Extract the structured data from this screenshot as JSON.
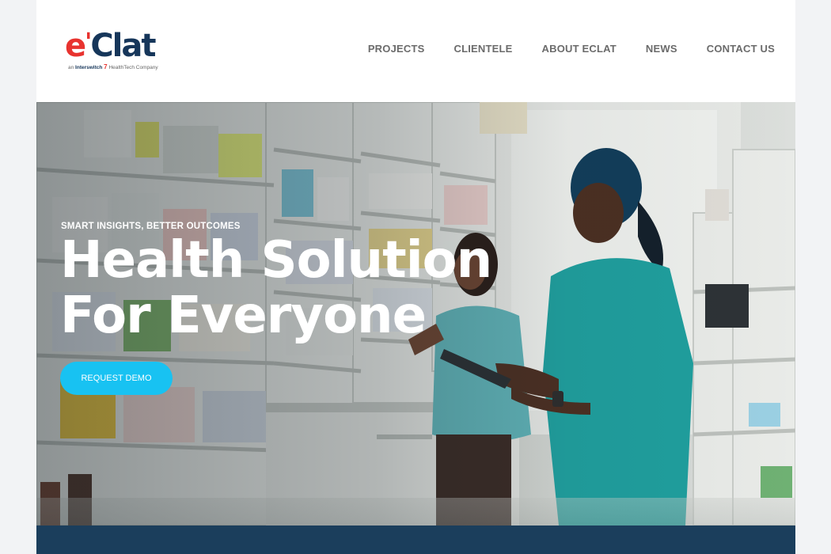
{
  "logo": {
    "e": "e",
    "apos": "'",
    "clat": "Clat",
    "tag_prefix": "an",
    "tag_brand": "Interswitch",
    "tag_mark": "7",
    "tag_suffix": "HealthTech Company"
  },
  "nav": {
    "items": [
      {
        "label": "PROJECTS"
      },
      {
        "label": "CLIENTELE"
      },
      {
        "label": "ABOUT ECLAT"
      },
      {
        "label": "NEWS"
      },
      {
        "label": "CONTACT US"
      }
    ]
  },
  "hero": {
    "eyebrow": "SMART INSIGHTS, BETTER OUTCOMES",
    "headline_line1": "Health Solution",
    "headline_line2": "For Everyone",
    "cta_label": "REQUEST DEMO",
    "photo": "pharmacy-staff-photo"
  },
  "colors": {
    "brand_red": "#e8332f",
    "brand_navy": "#16365a",
    "cta_blue": "#18c2f2",
    "footer_band": "#1b3e5c",
    "nav_text": "#6b6b6b"
  }
}
